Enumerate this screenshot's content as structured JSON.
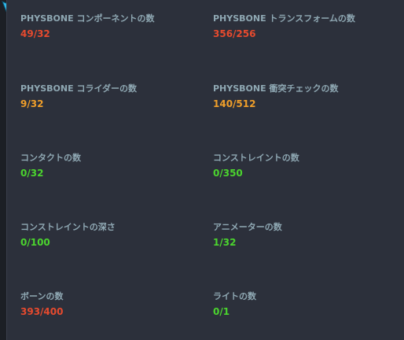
{
  "stats": [
    {
      "label": "PHYSBONE コンポーネントの数",
      "value": "49/32",
      "status": "red"
    },
    {
      "label": "PHYSBONE トランスフォームの数",
      "value": "356/256",
      "status": "red"
    },
    {
      "label": "PHYSBONE コライダーの数",
      "value": "9/32",
      "status": "orange"
    },
    {
      "label": "PHYSBONE 衝突チェックの数",
      "value": "140/512",
      "status": "orange"
    },
    {
      "label": "コンタクトの数",
      "value": "0/32",
      "status": "green"
    },
    {
      "label": "コンストレイントの数",
      "value": "0/350",
      "status": "green"
    },
    {
      "label": "コンストレイントの深さ",
      "value": "0/100",
      "status": "green"
    },
    {
      "label": "アニメーターの数",
      "value": "1/32",
      "status": "green"
    },
    {
      "label": "ボーンの数",
      "value": "393/400",
      "status": "red"
    },
    {
      "label": "ライトの数",
      "value": "0/1",
      "status": "green"
    }
  ],
  "colors": {
    "red": "#e64a2e",
    "orange": "#ef9e2a",
    "green": "#4bd42e",
    "label": "#8fa8b3"
  },
  "icons": {
    "corner": "cursor-arrow-icon"
  }
}
